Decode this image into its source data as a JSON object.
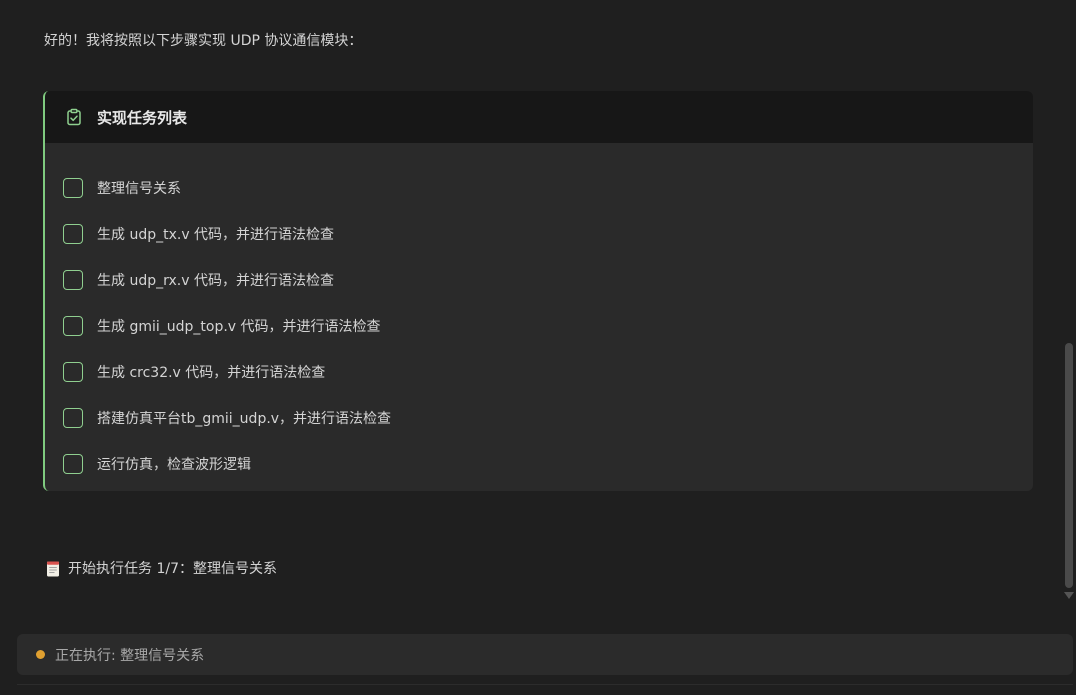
{
  "intro": {
    "text": "好的！我将按照以下步骤实现 UDP 协议通信模块："
  },
  "task_card": {
    "title": "实现任务列表",
    "header_icon": "clipboard-check-icon",
    "accent_color": "#7fca7f",
    "items": [
      {
        "label": "整理信号关系",
        "checked": false
      },
      {
        "label": "生成 udp_tx.v 代码，并进行语法检查",
        "checked": false
      },
      {
        "label": "生成 udp_rx.v 代码，并进行语法检查",
        "checked": false
      },
      {
        "label": "生成 gmii_udp_top.v 代码，并进行语法检查",
        "checked": false
      },
      {
        "label": "生成 crc32.v 代码，并进行语法检查",
        "checked": false
      },
      {
        "label": "搭建仿真平台tb_gmii_udp.v，并进行语法检查",
        "checked": false
      },
      {
        "label": "运行仿真，检查波形逻辑",
        "checked": false
      }
    ]
  },
  "start_message": {
    "icon": "memo-icon",
    "text": "开始执行任务 1/7：整理信号关系"
  },
  "status_bar": {
    "dot_color": "#e0a030",
    "text": "正在执行: 整理信号关系"
  }
}
